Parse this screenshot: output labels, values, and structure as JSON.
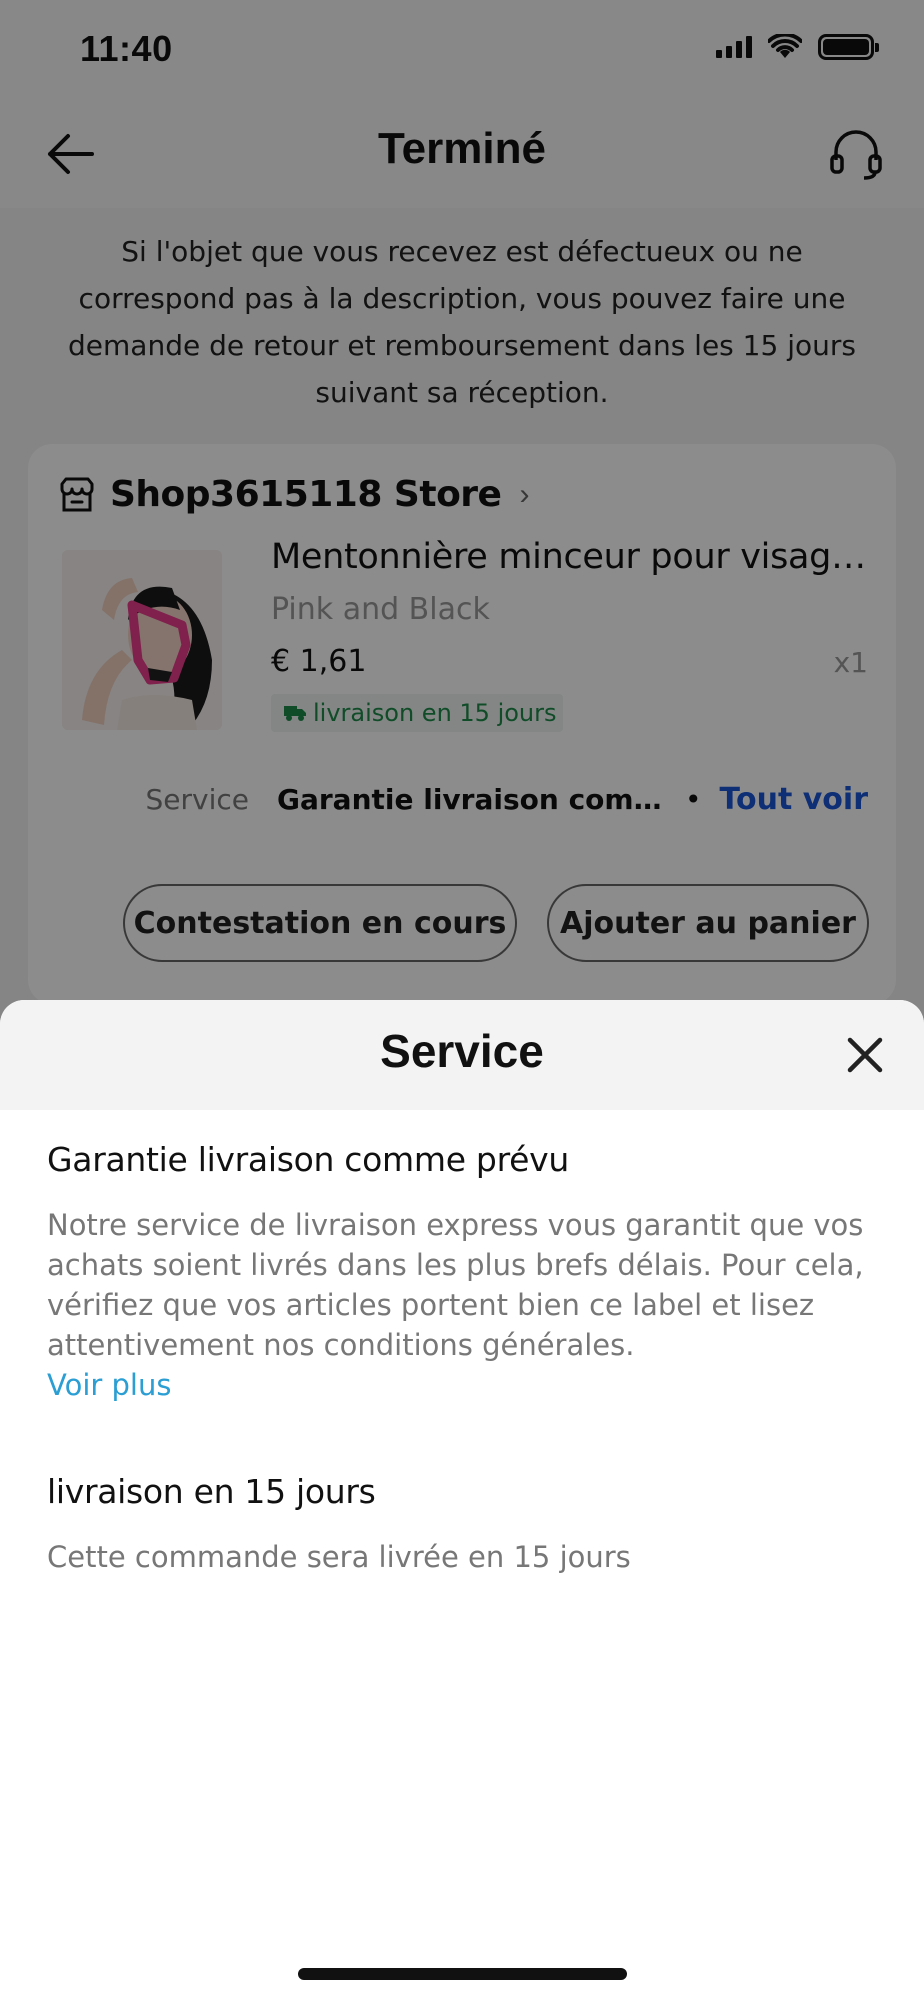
{
  "status_bar": {
    "time": "11:40"
  },
  "nav": {
    "title": "Terminé"
  },
  "notice": "Si l'objet que vous recevez est défectueux ou ne correspond pas à la description, vous pouvez faire une demande de retour et remboursement dans les 15 jours suivant sa réception.",
  "order": {
    "store_name": "Shop3615118 Store",
    "product": {
      "title": "Mentonnière minceur pour visage réutilisable",
      "variant": "Pink and Black",
      "price": "€ 1,61",
      "quantity": "x1",
      "delivery_badge": "livraison en 15 jours"
    },
    "service": {
      "label": "Service",
      "value": "Garantie livraison comme prévu",
      "link": "Tout voir"
    },
    "buttons": {
      "dispute": "Contestation en cours",
      "add_to_cart": "Ajouter au panier"
    }
  },
  "sheet": {
    "title": "Service",
    "sections": [
      {
        "title": "Garantie livraison comme prévu",
        "description": "Notre service de livraison express vous garantit que vos achats soient livrés dans les plus brefs délais. Pour cela, vérifiez que vos articles portent bien ce label et lisez attentivement nos conditions générales.",
        "link": "Voir plus"
      },
      {
        "title": "livraison en 15 jours",
        "description": "Cette commande sera livrée en 15 jours"
      }
    ]
  },
  "colors": {
    "link_blue": "#1a57d6",
    "link_teal": "#2b9ed3",
    "delivery_green": "#1f8a4c"
  }
}
